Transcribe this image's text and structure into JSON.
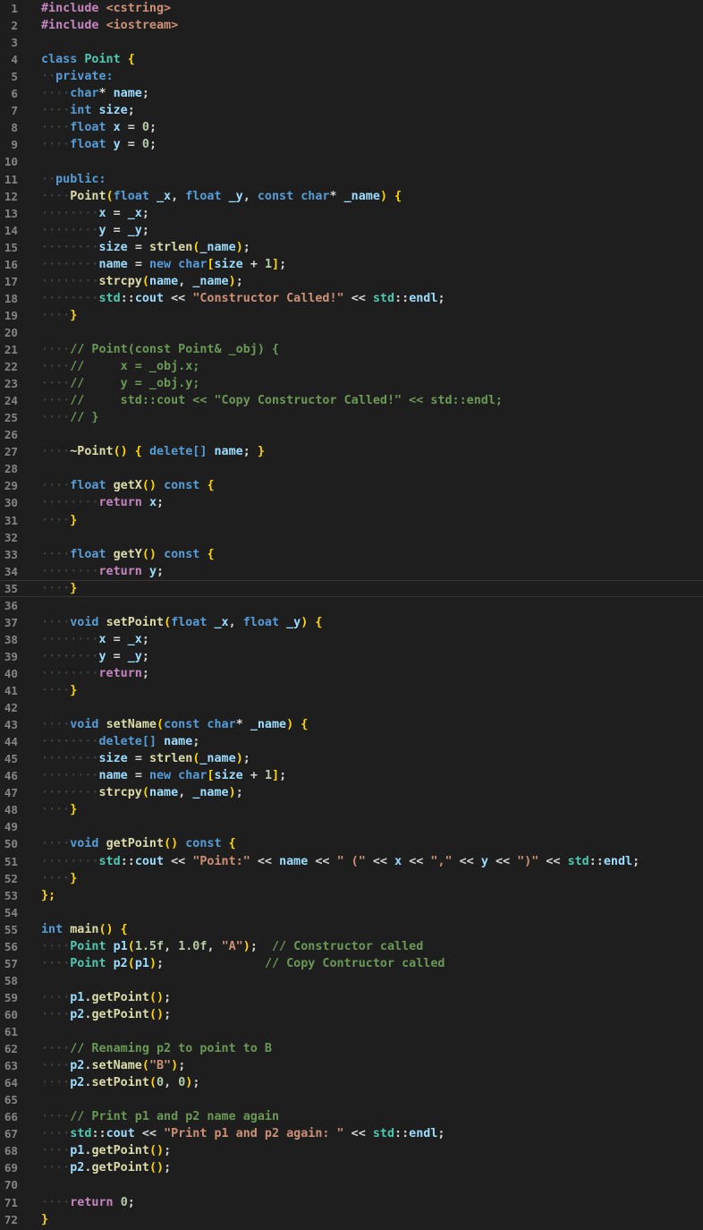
{
  "theme": {
    "background": "#1e1e1e",
    "colors": {
      "pp": "#c586c0",
      "kw": "#569cd6",
      "ty": "#4ec9b0",
      "id": "#9cdcfe",
      "fn": "#dcdcaa",
      "str": "#ce9178",
      "num": "#b5cea8",
      "cm": "#6a9955",
      "op": "#d4d4d4",
      "br": "#ffd700",
      "cf": "#c586c0"
    }
  },
  "editor": {
    "current_line": 35,
    "lines": [
      [
        [
          "pp",
          "#include "
        ],
        [
          "str",
          "<cstring>"
        ]
      ],
      [
        [
          "pp",
          "#include "
        ],
        [
          "str",
          "<iostream>"
        ]
      ],
      [],
      [
        [
          "kw",
          "class "
        ],
        [
          "ty",
          "Point "
        ],
        [
          "br",
          "{"
        ]
      ],
      [
        [
          "kw",
          "  private:"
        ]
      ],
      [
        [
          "kw",
          "    char"
        ],
        [
          "op",
          "* "
        ],
        [
          "id",
          "name"
        ],
        [
          "op",
          ";"
        ]
      ],
      [
        [
          "kw",
          "    int "
        ],
        [
          "id",
          "size"
        ],
        [
          "op",
          ";"
        ]
      ],
      [
        [
          "kw",
          "    float "
        ],
        [
          "id",
          "x "
        ],
        [
          "op",
          "= "
        ],
        [
          "num",
          "0"
        ],
        [
          "op",
          ";"
        ]
      ],
      [
        [
          "kw",
          "    float "
        ],
        [
          "id",
          "y "
        ],
        [
          "op",
          "= "
        ],
        [
          "num",
          "0"
        ],
        [
          "op",
          ";"
        ]
      ],
      [],
      [
        [
          "kw",
          "  public:"
        ]
      ],
      [
        [
          "fn",
          "    Point"
        ],
        [
          "br",
          "("
        ],
        [
          "kw",
          "float "
        ],
        [
          "id",
          "_x"
        ],
        [
          "op",
          ", "
        ],
        [
          "kw",
          "float "
        ],
        [
          "id",
          "_y"
        ],
        [
          "op",
          ", "
        ],
        [
          "kw",
          "const char"
        ],
        [
          "op",
          "* "
        ],
        [
          "id",
          "_name"
        ],
        [
          "br",
          ") {"
        ]
      ],
      [
        [
          "id",
          "        x "
        ],
        [
          "op",
          "= "
        ],
        [
          "id",
          "_x"
        ],
        [
          "op",
          ";"
        ]
      ],
      [
        [
          "id",
          "        y "
        ],
        [
          "op",
          "= "
        ],
        [
          "id",
          "_y"
        ],
        [
          "op",
          ";"
        ]
      ],
      [
        [
          "id",
          "        size "
        ],
        [
          "op",
          "= "
        ],
        [
          "fn",
          "strlen"
        ],
        [
          "br",
          "("
        ],
        [
          "id",
          "_name"
        ],
        [
          "br",
          ")"
        ],
        [
          "op",
          ";"
        ]
      ],
      [
        [
          "id",
          "        name "
        ],
        [
          "op",
          "= "
        ],
        [
          "kw",
          "new char"
        ],
        [
          "br",
          "["
        ],
        [
          "id",
          "size "
        ],
        [
          "op",
          "+ "
        ],
        [
          "num",
          "1"
        ],
        [
          "br",
          "]"
        ],
        [
          "op",
          ";"
        ]
      ],
      [
        [
          "fn",
          "        strcpy"
        ],
        [
          "br",
          "("
        ],
        [
          "id",
          "name"
        ],
        [
          "op",
          ", "
        ],
        [
          "id",
          "_name"
        ],
        [
          "br",
          ")"
        ],
        [
          "op",
          ";"
        ]
      ],
      [
        [
          "ty",
          "        std"
        ],
        [
          "op",
          "::"
        ],
        [
          "id",
          "cout "
        ],
        [
          "op",
          "<< "
        ],
        [
          "str",
          "\"Constructor Called!\" "
        ],
        [
          "op",
          "<< "
        ],
        [
          "ty",
          "std"
        ],
        [
          "op",
          "::"
        ],
        [
          "id",
          "endl"
        ],
        [
          "op",
          ";"
        ]
      ],
      [
        [
          "br",
          "    }"
        ]
      ],
      [],
      [
        [
          "cm",
          "    // Point(const Point& _obj) {"
        ]
      ],
      [
        [
          "cm",
          "    //     x = _obj.x;"
        ]
      ],
      [
        [
          "cm",
          "    //     y = _obj.y;"
        ]
      ],
      [
        [
          "cm",
          "    //     std::cout << \"Copy Constructor Called!\" << std::endl;"
        ]
      ],
      [
        [
          "cm",
          "    // }"
        ]
      ],
      [],
      [
        [
          "fn",
          "    ~Point"
        ],
        [
          "br",
          "() { "
        ],
        [
          "kw",
          "delete[] "
        ],
        [
          "id",
          "name"
        ],
        [
          "op",
          "; "
        ],
        [
          "br",
          "}"
        ]
      ],
      [],
      [
        [
          "kw",
          "    float "
        ],
        [
          "fn",
          "getX"
        ],
        [
          "br",
          "() "
        ],
        [
          "kw",
          "const "
        ],
        [
          "br",
          "{"
        ]
      ],
      [
        [
          "cf",
          "        return "
        ],
        [
          "id",
          "x"
        ],
        [
          "op",
          ";"
        ]
      ],
      [
        [
          "br",
          "    }"
        ]
      ],
      [],
      [
        [
          "kw",
          "    float "
        ],
        [
          "fn",
          "getY"
        ],
        [
          "br",
          "() "
        ],
        [
          "kw",
          "const "
        ],
        [
          "br",
          "{"
        ]
      ],
      [
        [
          "cf",
          "        return "
        ],
        [
          "id",
          "y"
        ],
        [
          "op",
          ";"
        ]
      ],
      [
        [
          "br",
          "    }"
        ]
      ],
      [],
      [
        [
          "kw",
          "    void "
        ],
        [
          "fn",
          "setPoint"
        ],
        [
          "br",
          "("
        ],
        [
          "kw",
          "float "
        ],
        [
          "id",
          "_x"
        ],
        [
          "op",
          ", "
        ],
        [
          "kw",
          "float "
        ],
        [
          "id",
          "_y"
        ],
        [
          "br",
          ") {"
        ]
      ],
      [
        [
          "id",
          "        x "
        ],
        [
          "op",
          "= "
        ],
        [
          "id",
          "_x"
        ],
        [
          "op",
          ";"
        ]
      ],
      [
        [
          "id",
          "        y "
        ],
        [
          "op",
          "= "
        ],
        [
          "id",
          "_y"
        ],
        [
          "op",
          ";"
        ]
      ],
      [
        [
          "cf",
          "        return"
        ],
        [
          "op",
          ";"
        ]
      ],
      [
        [
          "br",
          "    }"
        ]
      ],
      [],
      [
        [
          "kw",
          "    void "
        ],
        [
          "fn",
          "setName"
        ],
        [
          "br",
          "("
        ],
        [
          "kw",
          "const char"
        ],
        [
          "op",
          "* "
        ],
        [
          "id",
          "_name"
        ],
        [
          "br",
          ") {"
        ]
      ],
      [
        [
          "kw",
          "        delete[] "
        ],
        [
          "id",
          "name"
        ],
        [
          "op",
          ";"
        ]
      ],
      [
        [
          "id",
          "        size "
        ],
        [
          "op",
          "= "
        ],
        [
          "fn",
          "strlen"
        ],
        [
          "br",
          "("
        ],
        [
          "id",
          "_name"
        ],
        [
          "br",
          ")"
        ],
        [
          "op",
          ";"
        ]
      ],
      [
        [
          "id",
          "        name "
        ],
        [
          "op",
          "= "
        ],
        [
          "kw",
          "new char"
        ],
        [
          "br",
          "["
        ],
        [
          "id",
          "size "
        ],
        [
          "op",
          "+ "
        ],
        [
          "num",
          "1"
        ],
        [
          "br",
          "]"
        ],
        [
          "op",
          ";"
        ]
      ],
      [
        [
          "fn",
          "        strcpy"
        ],
        [
          "br",
          "("
        ],
        [
          "id",
          "name"
        ],
        [
          "op",
          ", "
        ],
        [
          "id",
          "_name"
        ],
        [
          "br",
          ")"
        ],
        [
          "op",
          ";"
        ]
      ],
      [
        [
          "br",
          "    }"
        ]
      ],
      [],
      [
        [
          "kw",
          "    void "
        ],
        [
          "fn",
          "getPoint"
        ],
        [
          "br",
          "() "
        ],
        [
          "kw",
          "const "
        ],
        [
          "br",
          "{"
        ]
      ],
      [
        [
          "ty",
          "        std"
        ],
        [
          "op",
          "::"
        ],
        [
          "id",
          "cout "
        ],
        [
          "op",
          "<< "
        ],
        [
          "str",
          "\"Point:\" "
        ],
        [
          "op",
          "<< "
        ],
        [
          "id",
          "name "
        ],
        [
          "op",
          "<< "
        ],
        [
          "str",
          "\" (\" "
        ],
        [
          "op",
          "<< "
        ],
        [
          "id",
          "x "
        ],
        [
          "op",
          "<< "
        ],
        [
          "str",
          "\",\" "
        ],
        [
          "op",
          "<< "
        ],
        [
          "id",
          "y "
        ],
        [
          "op",
          "<< "
        ],
        [
          "str",
          "\")\" "
        ],
        [
          "op",
          "<< "
        ],
        [
          "ty",
          "std"
        ],
        [
          "op",
          "::"
        ],
        [
          "id",
          "endl"
        ],
        [
          "op",
          ";"
        ]
      ],
      [
        [
          "br",
          "    }"
        ]
      ],
      [
        [
          "br",
          "};"
        ]
      ],
      [],
      [
        [
          "kw",
          "int "
        ],
        [
          "fn",
          "main"
        ],
        [
          "br",
          "() {"
        ]
      ],
      [
        [
          "ty",
          "    Point "
        ],
        [
          "id",
          "p1"
        ],
        [
          "br",
          "("
        ],
        [
          "num",
          "1.5f"
        ],
        [
          "op",
          ", "
        ],
        [
          "num",
          "1.0f"
        ],
        [
          "op",
          ", "
        ],
        [
          "str",
          "\"A\""
        ],
        [
          "br",
          ")"
        ],
        [
          "op",
          ";  "
        ],
        [
          "cm",
          "// Constructor called"
        ]
      ],
      [
        [
          "ty",
          "    Point "
        ],
        [
          "id",
          "p2"
        ],
        [
          "br",
          "("
        ],
        [
          "id",
          "p1"
        ],
        [
          "br",
          ")"
        ],
        [
          "op",
          ";              "
        ],
        [
          "cm",
          "// Copy Contructor called"
        ]
      ],
      [],
      [
        [
          "id",
          "    p1"
        ],
        [
          "op",
          "."
        ],
        [
          "fn",
          "getPoint"
        ],
        [
          "br",
          "()"
        ],
        [
          "op",
          ";"
        ]
      ],
      [
        [
          "id",
          "    p2"
        ],
        [
          "op",
          "."
        ],
        [
          "fn",
          "getPoint"
        ],
        [
          "br",
          "()"
        ],
        [
          "op",
          ";"
        ]
      ],
      [],
      [
        [
          "cm",
          "    // Renaming p2 to point to B"
        ]
      ],
      [
        [
          "id",
          "    p2"
        ],
        [
          "op",
          "."
        ],
        [
          "fn",
          "setName"
        ],
        [
          "br",
          "("
        ],
        [
          "str",
          "\"B\""
        ],
        [
          "br",
          ")"
        ],
        [
          "op",
          ";"
        ]
      ],
      [
        [
          "id",
          "    p2"
        ],
        [
          "op",
          "."
        ],
        [
          "fn",
          "setPoint"
        ],
        [
          "br",
          "("
        ],
        [
          "num",
          "0"
        ],
        [
          "op",
          ", "
        ],
        [
          "num",
          "0"
        ],
        [
          "br",
          ")"
        ],
        [
          "op",
          ";"
        ]
      ],
      [],
      [
        [
          "cm",
          "    // Print p1 and p2 name again"
        ]
      ],
      [
        [
          "ty",
          "    std"
        ],
        [
          "op",
          "::"
        ],
        [
          "id",
          "cout "
        ],
        [
          "op",
          "<< "
        ],
        [
          "str",
          "\"Print p1 and p2 again: \" "
        ],
        [
          "op",
          "<< "
        ],
        [
          "ty",
          "std"
        ],
        [
          "op",
          "::"
        ],
        [
          "id",
          "endl"
        ],
        [
          "op",
          ";"
        ]
      ],
      [
        [
          "id",
          "    p1"
        ],
        [
          "op",
          "."
        ],
        [
          "fn",
          "getPoint"
        ],
        [
          "br",
          "()"
        ],
        [
          "op",
          ";"
        ]
      ],
      [
        [
          "id",
          "    p2"
        ],
        [
          "op",
          "."
        ],
        [
          "fn",
          "getPoint"
        ],
        [
          "br",
          "()"
        ],
        [
          "op",
          ";"
        ]
      ],
      [],
      [
        [
          "cf",
          "    return "
        ],
        [
          "num",
          "0"
        ],
        [
          "op",
          ";"
        ]
      ],
      [
        [
          "br",
          "}"
        ]
      ]
    ]
  }
}
